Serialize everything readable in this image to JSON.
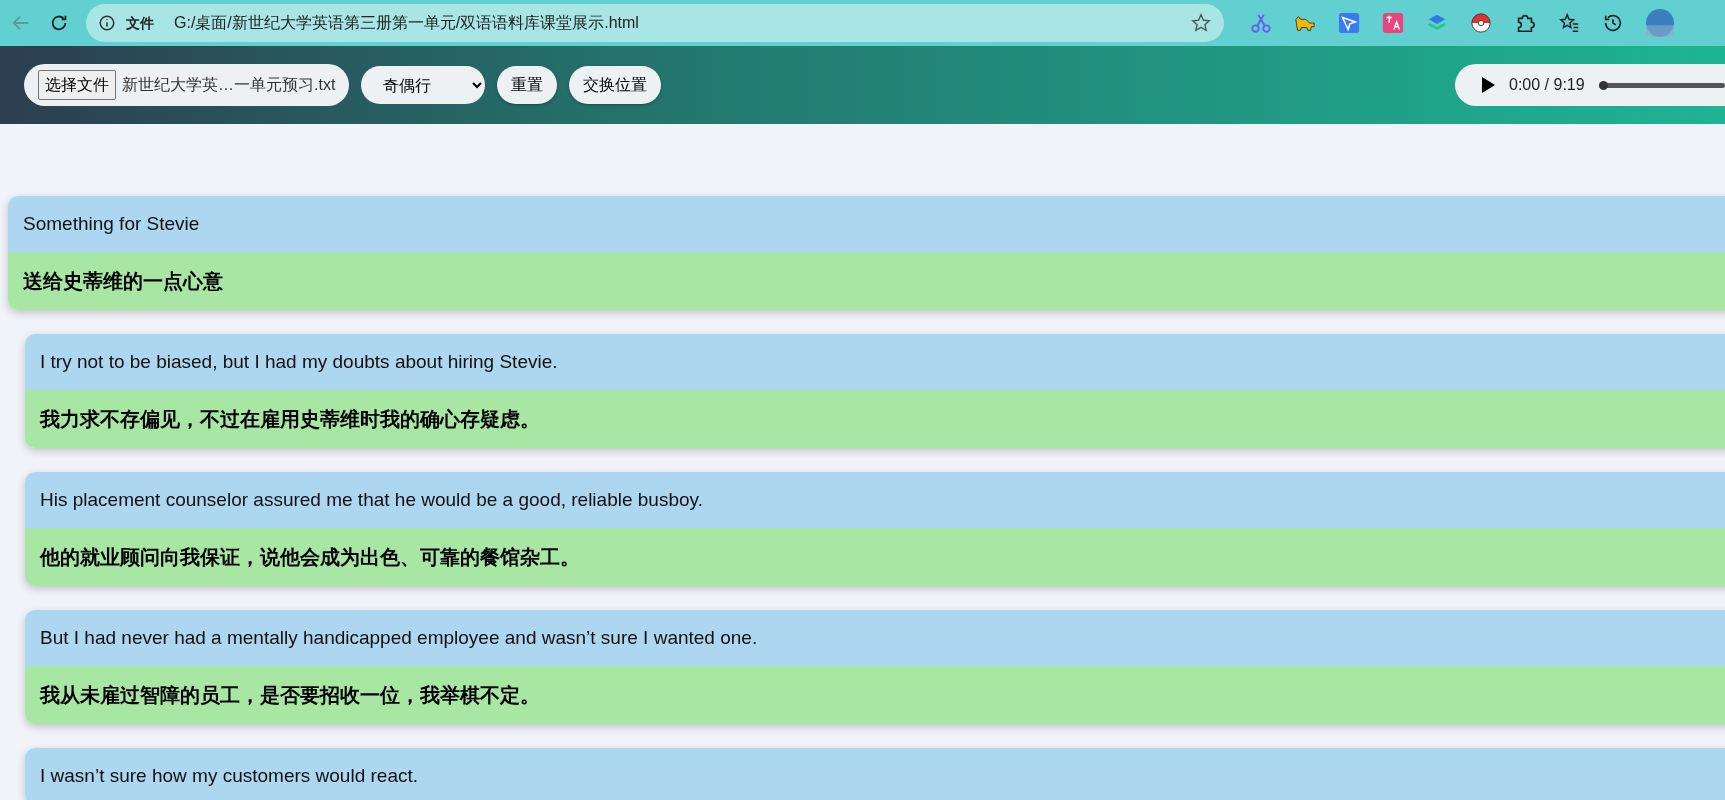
{
  "browser": {
    "security_label": "文件",
    "url": "G:/桌面/新世纪大学英语第三册第一单元/双语语料库课堂展示.html"
  },
  "toolbar": {
    "file_button": "选择文件",
    "file_name": "新世纪大学英…一单元预习.txt",
    "mode_select": "奇偶行",
    "reset_button": "重置",
    "swap_button": "交换位置"
  },
  "audio": {
    "time": "0:00 / 9:19",
    "level": 0
  },
  "cards": [
    {
      "kind": "title",
      "english": "Something for Stevie",
      "chinese": "送给史蒂维的一点心意"
    },
    {
      "kind": "sentence",
      "english": "I try not to be biased, but I had my doubts about hiring Stevie.",
      "chinese": "我力求不存偏见，不过在雇用史蒂维时我的确心存疑虑。"
    },
    {
      "kind": "sentence",
      "english": "His placement counselor assured me that he would be a good, reliable busboy.",
      "chinese": "他的就业顾问向我保证，说他会成为出色、可靠的餐馆杂工。"
    },
    {
      "kind": "sentence",
      "english": "But I had never had a mentally handicapped employee and wasn’t sure I wanted one.",
      "chinese": "我从未雇过智障的员工，是否要招收一位，我举棋不定。"
    },
    {
      "kind": "sentence",
      "english": "I wasn’t sure how my customers would react."
    }
  ]
}
